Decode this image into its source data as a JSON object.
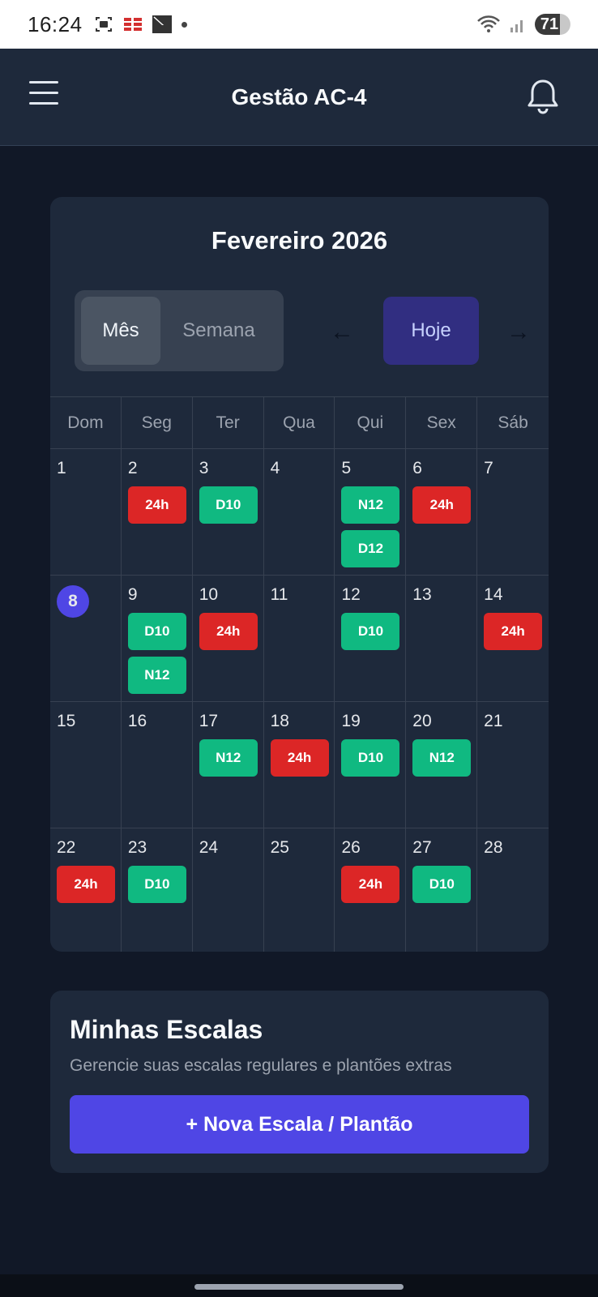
{
  "status_bar": {
    "time": "16:24",
    "battery": "71",
    "icons": [
      "screenshot-icon",
      "bank-app-icon",
      "xp-app-icon",
      "wifi-icon",
      "signal-icon"
    ]
  },
  "header": {
    "title": "Gestão AC-4",
    "menu_icon": "hamburger-menu-icon",
    "bell_icon": "bell-icon"
  },
  "calendar": {
    "month_title": "Fevereiro 2026",
    "view_month": "Mês",
    "view_week": "Semana",
    "prev": "←",
    "today": "Hoje",
    "next": "→",
    "weekdays": [
      "Dom",
      "Seg",
      "Ter",
      "Qua",
      "Qui",
      "Sex",
      "Sáb"
    ],
    "weeks": [
      [
        {
          "day": "1",
          "shifts": []
        },
        {
          "day": "2",
          "shifts": [
            {
              "label": "24h",
              "color": "#dc2626"
            }
          ]
        },
        {
          "day": "3",
          "shifts": [
            {
              "label": "D10",
              "color": "#10b981"
            }
          ]
        },
        {
          "day": "4",
          "shifts": []
        },
        {
          "day": "5",
          "shifts": [
            {
              "label": "N12",
              "color": "#10b981"
            },
            {
              "label": "D12",
              "color": "#10b981"
            }
          ]
        },
        {
          "day": "6",
          "shifts": [
            {
              "label": "24h",
              "color": "#dc2626"
            }
          ]
        },
        {
          "day": "7",
          "shifts": []
        }
      ],
      [
        {
          "day": "8",
          "today": true,
          "shifts": []
        },
        {
          "day": "9",
          "shifts": [
            {
              "label": "D10",
              "color": "#10b981"
            },
            {
              "label": "N12",
              "color": "#10b981"
            }
          ]
        },
        {
          "day": "10",
          "shifts": [
            {
              "label": "24h",
              "color": "#dc2626"
            }
          ]
        },
        {
          "day": "11",
          "shifts": []
        },
        {
          "day": "12",
          "shifts": [
            {
              "label": "D10",
              "color": "#10b981"
            }
          ]
        },
        {
          "day": "13",
          "shifts": []
        },
        {
          "day": "14",
          "shifts": [
            {
              "label": "24h",
              "color": "#dc2626"
            }
          ]
        }
      ],
      [
        {
          "day": "15",
          "shifts": []
        },
        {
          "day": "16",
          "shifts": []
        },
        {
          "day": "17",
          "shifts": [
            {
              "label": "N12",
              "color": "#10b981"
            }
          ]
        },
        {
          "day": "18",
          "shifts": [
            {
              "label": "24h",
              "color": "#dc2626"
            }
          ]
        },
        {
          "day": "19",
          "shifts": [
            {
              "label": "D10",
              "color": "#10b981"
            }
          ]
        },
        {
          "day": "20",
          "shifts": [
            {
              "label": "N12",
              "color": "#10b981"
            }
          ]
        },
        {
          "day": "21",
          "shifts": []
        }
      ],
      [
        {
          "day": "22",
          "shifts": [
            {
              "label": "24h",
              "color": "#dc2626"
            }
          ]
        },
        {
          "day": "23",
          "shifts": [
            {
              "label": "D10",
              "color": "#10b981"
            }
          ]
        },
        {
          "day": "24",
          "shifts": []
        },
        {
          "day": "25",
          "shifts": []
        },
        {
          "day": "26",
          "shifts": [
            {
              "label": "24h",
              "color": "#dc2626"
            }
          ]
        },
        {
          "day": "27",
          "shifts": [
            {
              "label": "D10",
              "color": "#10b981"
            }
          ]
        },
        {
          "day": "28",
          "shifts": []
        }
      ]
    ]
  },
  "escalas": {
    "title": "Minhas Escalas",
    "subtitle": "Gerencie suas escalas regulares e plantões extras",
    "new_button": "+ Nova Escala / Plantão"
  },
  "colors": {
    "accent": "#4f46e5",
    "shift_green": "#10b981",
    "shift_red": "#dc2626",
    "background": "#111827",
    "card": "#1e293b"
  }
}
